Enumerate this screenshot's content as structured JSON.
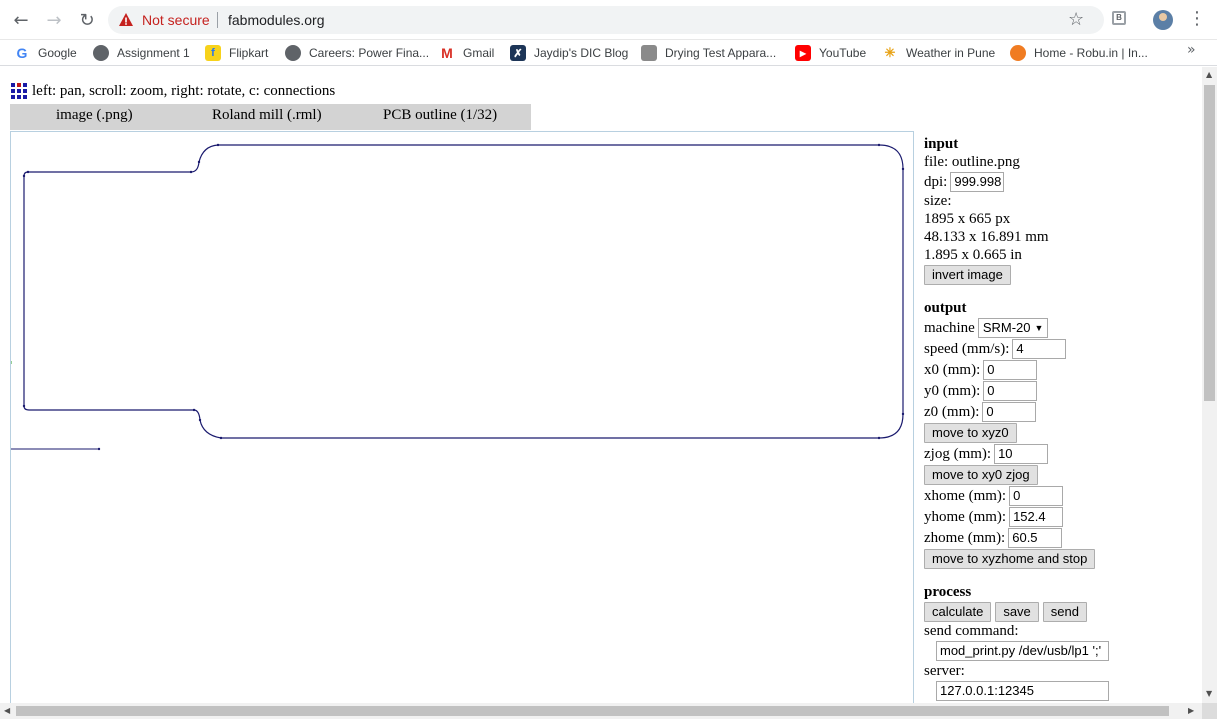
{
  "browser": {
    "security_label": "Not secure",
    "url": "fabmodules.org",
    "bookmarks": [
      {
        "label": "Google",
        "icon": "google-icon"
      },
      {
        "label": "Assignment 1",
        "icon": "globe-icon"
      },
      {
        "label": "Flipkart",
        "icon": "flipkart-icon"
      },
      {
        "label": "Careers: Power Fina...",
        "icon": "globe-icon"
      },
      {
        "label": "Gmail",
        "icon": "gmail-icon"
      },
      {
        "label": "Jaydip's DIC Blog",
        "icon": "blog-icon"
      },
      {
        "label": "Drying Test Appara...",
        "icon": "image-icon"
      },
      {
        "label": "YouTube",
        "icon": "youtube-icon"
      },
      {
        "label": "Weather in Pune",
        "icon": "weather-icon"
      },
      {
        "label": "Home - Robu.in | In...",
        "icon": "robu-icon"
      }
    ]
  },
  "page": {
    "hint": "left: pan, scroll: zoom, right: rotate, c: connections",
    "tabs": [
      "image (.png)",
      "Roland mill (.rml)",
      "PCB outline (1/32)"
    ]
  },
  "input": {
    "heading": "input",
    "file": "file: outline.png",
    "dpi_label": "dpi:",
    "dpi_value": "999.998",
    "size_label": "size:",
    "size_px": "1895 x 665 px",
    "size_mm": "48.133 x 16.891 mm",
    "size_in": "1.895 x 0.665 in",
    "invert_button": "invert image"
  },
  "output": {
    "heading": "output",
    "machine_label": "machine",
    "machine_value": "SRM-20",
    "speed_label": "speed (mm/s):",
    "speed_value": "4",
    "x0_label": "x0 (mm):",
    "x0_value": "0",
    "y0_label": "y0 (mm):",
    "y0_value": "0",
    "z0_label": "z0 (mm):",
    "z0_value": "0",
    "move_xyz0_button": "move to xyz0",
    "zjog_label": "zjog (mm):",
    "zjog_value": "10",
    "move_xy0_button": "move to xy0 zjog",
    "xhome_label": "xhome (mm):",
    "xhome_value": "0",
    "yhome_label": "yhome (mm):",
    "yhome_value": "152.4",
    "zhome_label": "zhome (mm):",
    "zhome_value": "60.5",
    "move_home_button": "move to xyzhome and stop"
  },
  "process": {
    "heading": "process",
    "calculate_button": "calculate",
    "save_button": "save",
    "send_button": "send",
    "send_command_label": "send command:",
    "send_command_value": "mod_print.py /dev/usb/lp1 ';'",
    "server_label": "server:",
    "server_value": "127.0.0.1:12345"
  },
  "colors": {
    "toolpath": "#1a1a6e",
    "insecure": "#c5221f",
    "tab_bar": "#d3d3d3"
  }
}
